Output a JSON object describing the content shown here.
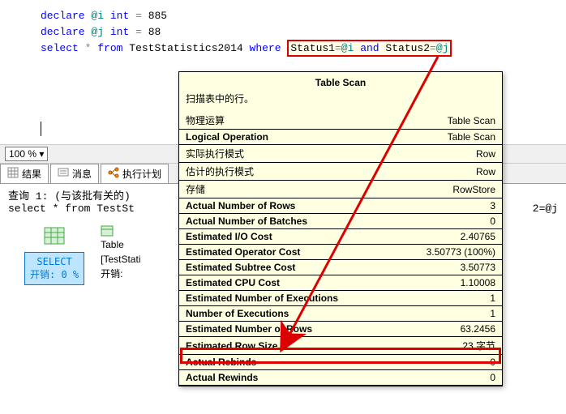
{
  "code": {
    "line1_kw1": "declare",
    "line1_var": "@i",
    "line1_kw2": "int",
    "line1_eq": "=",
    "line1_val": "885",
    "line2_kw1": "declare",
    "line2_var": "@j",
    "line2_kw2": "int",
    "line2_eq": "=",
    "line2_val": "88",
    "line3_kw1": "select",
    "line3_star": "*",
    "line3_kw2": "from",
    "line3_table": "TestStatistics2014",
    "line3_kw3": "where",
    "line3_cond_s1": "Status1",
    "line3_cond_eq1": "=",
    "line3_cond_v1": "@i",
    "line3_cond_and": "and",
    "line3_cond_s2": "Status2",
    "line3_cond_eq2": "=",
    "line3_cond_v2": "@j"
  },
  "zoom": {
    "value": "100 %",
    "chev": "▾"
  },
  "tabs": {
    "results": "结果",
    "messages": "消息",
    "plan": "执行计划"
  },
  "results": {
    "query_label": "查询 1:  (与该批有关的)",
    "query_sql_pre": "select * from TestSt",
    "query_sql_suf": "2=@j"
  },
  "plan": {
    "select_label": "SELECT\n开销: 0 %",
    "table_label": "Table",
    "obj": "[TestStati",
    "cost": "开销:"
  },
  "tooltip": {
    "title": "Table Scan",
    "desc": "扫描表中的行。",
    "rows": [
      {
        "k": "物理运算",
        "v": "Table Scan"
      },
      {
        "k": "Logical Operation",
        "v": "Table Scan"
      },
      {
        "k": "实际执行模式",
        "v": "Row"
      },
      {
        "k": "估计的执行模式",
        "v": "Row"
      },
      {
        "k": "存储",
        "v": "RowStore"
      },
      {
        "k": "Actual Number of Rows",
        "v": "3"
      },
      {
        "k": "Actual Number of Batches",
        "v": "0"
      },
      {
        "k": "Estimated I/O Cost",
        "v": "2.40765"
      },
      {
        "k": "Estimated Operator Cost",
        "v": "3.50773 (100%)"
      },
      {
        "k": "Estimated Subtree Cost",
        "v": "3.50773"
      },
      {
        "k": "Estimated CPU Cost",
        "v": "1.10008"
      },
      {
        "k": "Estimated Number of Executions",
        "v": "1"
      },
      {
        "k": "Number of Executions",
        "v": "1"
      },
      {
        "k": "Estimated Number of Rows",
        "v": "63.2456"
      },
      {
        "k": "Estimated Row Size",
        "v": "23 字节"
      },
      {
        "k": "Actual Rebinds",
        "v": "0"
      },
      {
        "k": "Actual Rewinds",
        "v": "0"
      }
    ]
  }
}
